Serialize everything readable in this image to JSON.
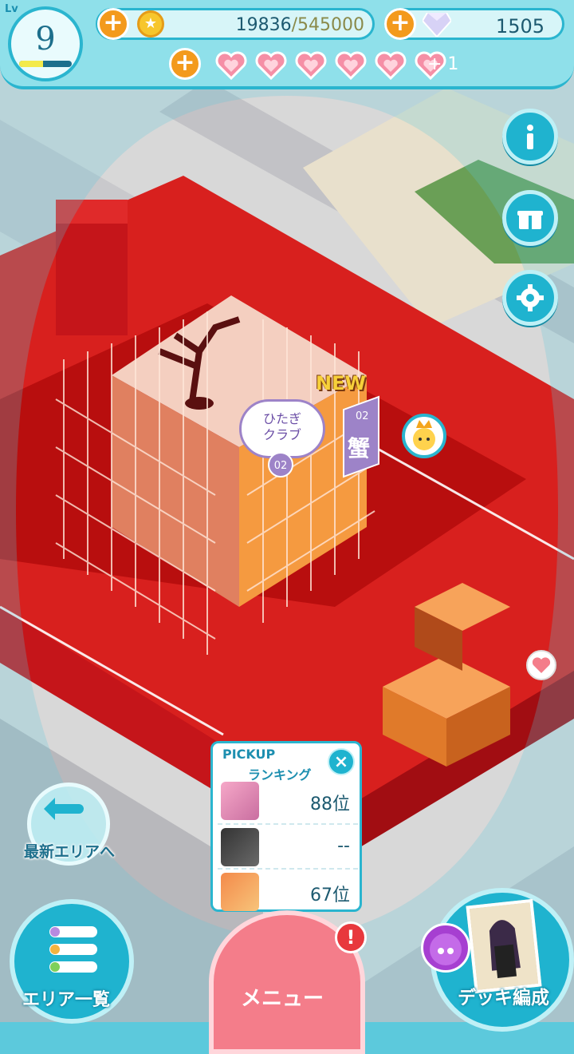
{
  "level": {
    "tag": "Lv",
    "value": "9",
    "progress": 0.45
  },
  "currency": {
    "coins_current": "19836",
    "coins_max": "/545000",
    "gems": "1505"
  },
  "hearts": {
    "count": 6,
    "extra": "+ 1"
  },
  "side_buttons": {
    "info": "info-icon",
    "gift": "gift-icon",
    "settings": "gear-icon"
  },
  "map": {
    "speech_line1": "ひたぎ",
    "speech_line2": "クラブ",
    "speech_badge": "02",
    "new_label": "NEW",
    "flag_number": "02",
    "flag_char": "蟹",
    "road_text": "ひたぎクラブ"
  },
  "ranking": {
    "title_line1": "PICKUP",
    "title_line2": "ランキング",
    "close": "×",
    "rows": [
      {
        "value": "88位"
      },
      {
        "value": "--"
      },
      {
        "value": "67位"
      }
    ]
  },
  "bottom": {
    "latest_label": "最新エリアへ",
    "area_label": "エリア一覧",
    "menu_label": "メニュー",
    "alert": "!",
    "deck_label": "デッキ編成"
  },
  "colors": {
    "accent": "#1fb3cf",
    "menu": "#f47d8a",
    "coin": "#f7c62c",
    "danger": "#e8383d"
  }
}
